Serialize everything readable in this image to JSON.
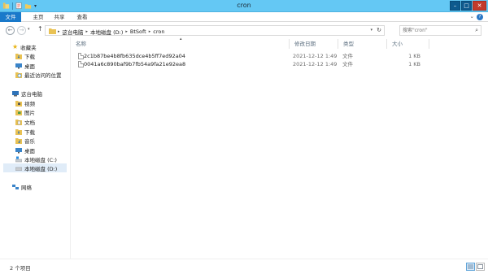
{
  "window": {
    "title": "cron"
  },
  "ribbon": {
    "tabs": {
      "file": "文件",
      "home": "主页",
      "share": "共享",
      "view": "查看"
    },
    "help": "?"
  },
  "address": {
    "crumbs": [
      "这台电脑",
      "本地磁盘 (D:)",
      "BtSoft",
      "cron"
    ]
  },
  "search": {
    "placeholder": "搜索\"cron\""
  },
  "sidebar": {
    "quick_access": {
      "label": "收藏夹",
      "items": [
        "下载",
        "桌面",
        "最近访问的位置"
      ]
    },
    "this_pc": {
      "label": "这台电脑",
      "items": [
        "视频",
        "图片",
        "文档",
        "下载",
        "音乐",
        "桌面",
        "本地磁盘 (C:)",
        "本地磁盘 (D:)"
      ]
    },
    "network": {
      "label": "网络"
    }
  },
  "columns": {
    "name": "名称",
    "modified": "修改日期",
    "type": "类型",
    "size": "大小"
  },
  "files": [
    {
      "name": "2c1b87be4b8fb635dce4b5ff7ed92a04",
      "modified": "2021-12-12 1:49",
      "type": "文件",
      "size": "1 KB"
    },
    {
      "name": "0041a6c890baf9b7fb54a9fa21e92ea8",
      "modified": "2021-12-12 1:49",
      "type": "文件",
      "size": "1 KB"
    }
  ],
  "status": {
    "item_count": "2 个项目"
  },
  "colors": {
    "titlebar": "#64c8f4",
    "file_tab": "#1979ca",
    "close_button": "#c23a2b",
    "selection": "#e0ecf8"
  }
}
